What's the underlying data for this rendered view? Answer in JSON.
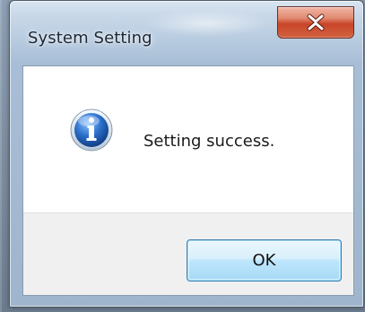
{
  "window": {
    "title": "System Setting",
    "close_button_icon": "close-icon"
  },
  "dialog": {
    "icon": "info-icon",
    "message": "Setting success.",
    "ok_label": "OK"
  },
  "colors": {
    "close_button_red": "#c8452a",
    "ok_button_blue": "#bee6fd",
    "info_icon_blue": "#2a6fc9",
    "button_bar_gray": "#f0f0f0"
  }
}
